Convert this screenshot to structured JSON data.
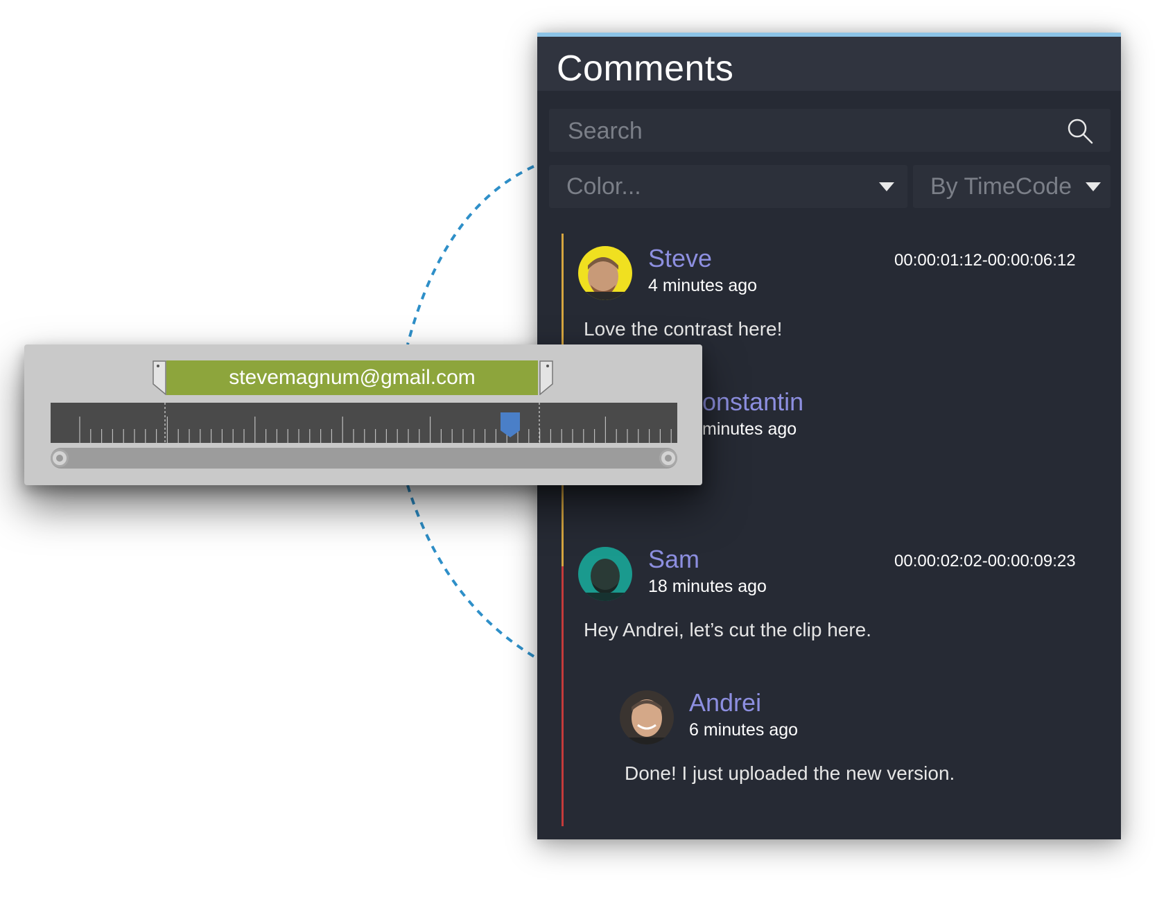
{
  "panel": {
    "title": "Comments",
    "search": {
      "placeholder": "Search",
      "value": ""
    },
    "filters": {
      "color": {
        "label": "Color..."
      },
      "sort": {
        "label": "By TimeCode"
      }
    },
    "accent_color": "#8cc3e6",
    "author_color": "#8d8fe0"
  },
  "comments": [
    {
      "author": "Steve",
      "time_ago": "4 minutes ago",
      "timecode": "00:00:01:12-00:00:06:12",
      "text": "Love the contrast here!",
      "avatar_ring_color": "#f0e020",
      "thread_color": "#d6a640"
    },
    {
      "author_partial": "onstantin",
      "time_ago_partial": "minutes ago"
    },
    {
      "author": "Sam",
      "time_ago": "18 minutes ago",
      "timecode": "00:00:02:02-00:00:09:23",
      "text": "Hey Andrei, let’s cut the clip here.",
      "avatar_ring_color": "#1a9a8e",
      "thread_color": "#c43a3a",
      "replies": [
        {
          "author": "Andrei",
          "time_ago": "6 minutes ago",
          "text": "Done! I just uploaded the new version."
        }
      ]
    }
  ],
  "timeline": {
    "range_label": "stevemagnum@gmail.com",
    "range_color": "#8da53c",
    "playhead_color": "#4a7fc8",
    "connector_color": "#2e8fc8"
  }
}
